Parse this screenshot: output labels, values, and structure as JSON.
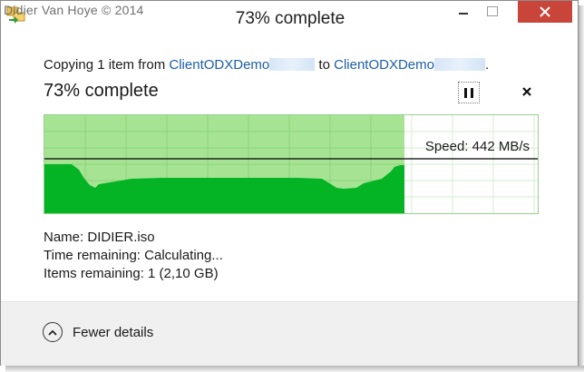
{
  "window": {
    "title": "73% complete",
    "watermark": "Didier Van Hoye © 2014"
  },
  "copy": {
    "prefix": "Copying 1 item from ",
    "source": "ClientODXDemo",
    "to": " to ",
    "destination": "ClientODXDemo",
    "suffix": "."
  },
  "progress": {
    "label": "73% complete",
    "fraction": 0.73
  },
  "graph": {
    "speed_label": "Speed: 442 MB/s",
    "colors": {
      "done_fill": "#a6e494",
      "speed_fill": "#04b425",
      "grid": "#d5ecd0",
      "speed_line": "#000000"
    }
  },
  "details": {
    "name_label": "Name:",
    "name_value": "DIDIER.iso",
    "time_label": "Time remaining:",
    "time_value": "Calculating...",
    "items_label": "Items remaining:",
    "items_value": "1 (2,10 GB)"
  },
  "footer": {
    "toggle_label": "Fewer details",
    "toggle_icon": "chevron-up-circle-icon"
  },
  "icons": {
    "app": "copy-files-icon",
    "pause": "pause-icon",
    "close": "close-icon"
  }
}
